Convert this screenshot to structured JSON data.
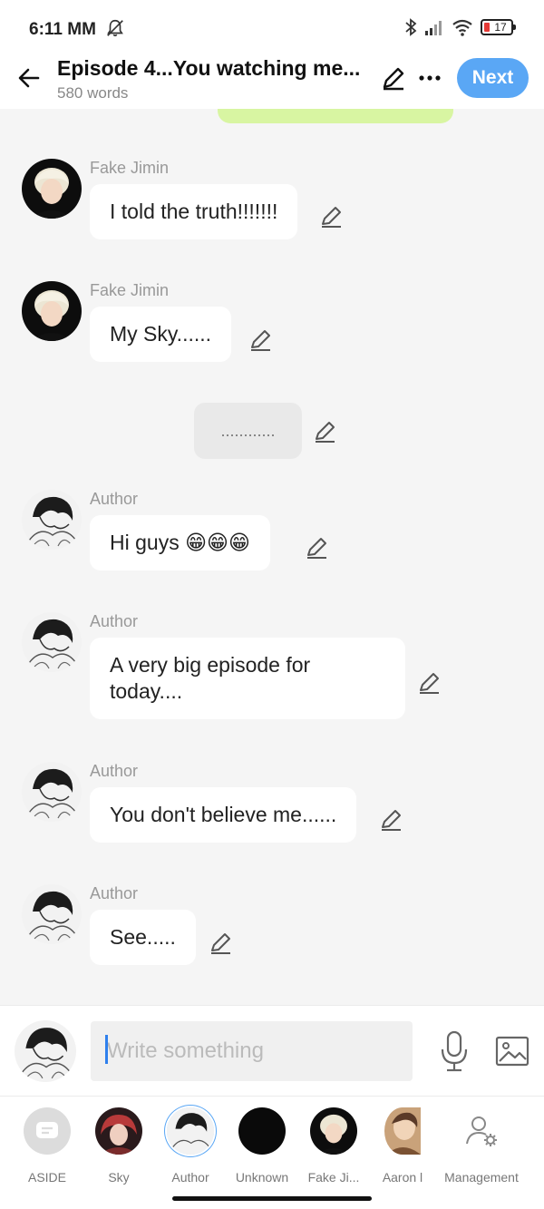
{
  "status_bar": {
    "time": "6:11 MM",
    "battery": "17"
  },
  "header": {
    "title": "Episode 4...You watching me...",
    "word_count": "580 words",
    "next_label": "Next"
  },
  "messages": [
    {
      "sender": "Fake Jimin",
      "text": "I told the truth!!!!!!!",
      "avatar": "fake-jimin"
    },
    {
      "sender": "Fake Jimin",
      "text": "My Sky......",
      "avatar": "fake-jimin"
    },
    {
      "aside": "............"
    },
    {
      "sender": "Author",
      "text": "Hi guys 😁😁😁",
      "avatar": "author"
    },
    {
      "sender": "Author",
      "text": "A very big episode for today....",
      "avatar": "author"
    },
    {
      "sender": "Author",
      "text": "You don't believe me......",
      "avatar": "author"
    },
    {
      "sender": "Author",
      "text": "See.....",
      "avatar": "author"
    }
  ],
  "aside_text": "............",
  "input": {
    "placeholder": "Write something"
  },
  "characters": [
    {
      "name": "ASIDE",
      "icon": "aside-icon"
    },
    {
      "name": "Sky",
      "icon": "sky-avatar"
    },
    {
      "name": "Author",
      "icon": "author-avatar",
      "selected": true
    },
    {
      "name": "Unknown",
      "icon": "unknown-avatar"
    },
    {
      "name": "Fake Ji...",
      "icon": "fake-jimin-avatar"
    },
    {
      "name": "Aaron l",
      "icon": "aaron-avatar"
    },
    {
      "name": "Management",
      "icon": "management-icon"
    }
  ],
  "colors": {
    "accent": "#5aa7f5",
    "prev_bubble": "#d8f5a2",
    "background": "#f5f5f5"
  }
}
